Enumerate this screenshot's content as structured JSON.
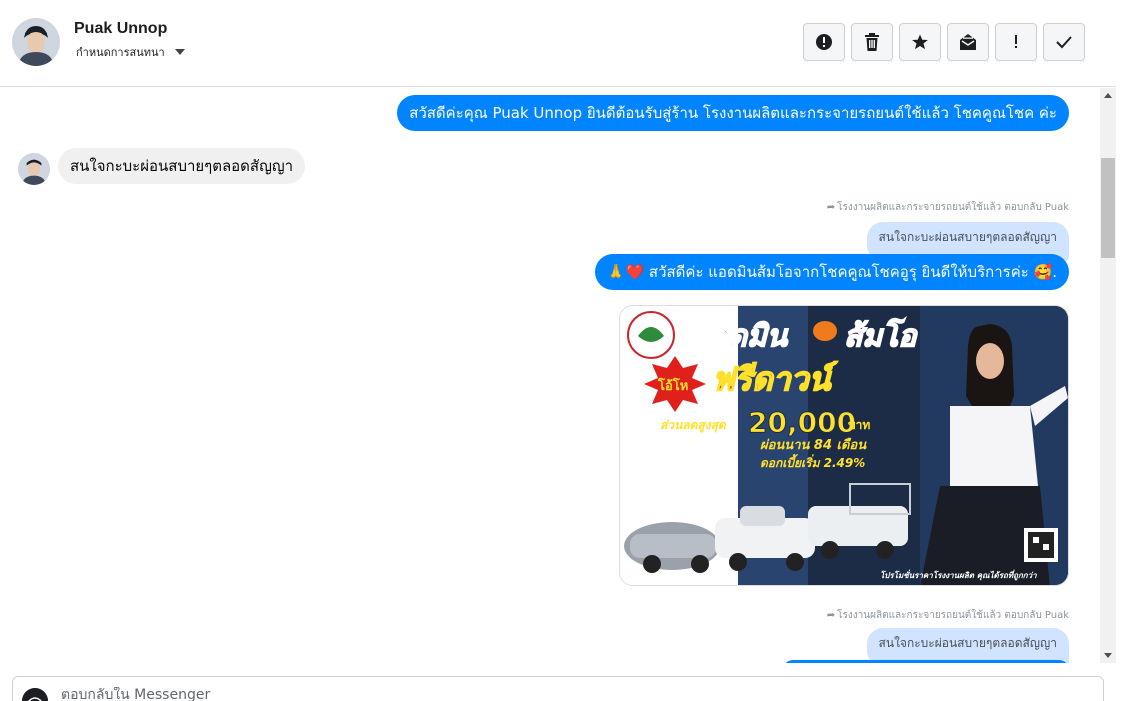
{
  "contact": {
    "name": "Puak Unnop",
    "assign_label": "กำหนดการสนทนา"
  },
  "toolbar": {
    "buttons": [
      {
        "name": "report-button",
        "icon": "alert-circle-icon"
      },
      {
        "name": "delete-button",
        "icon": "trash-icon"
      },
      {
        "name": "star-button",
        "icon": "star-icon"
      },
      {
        "name": "mark-unread-button",
        "icon": "envelope-icon"
      },
      {
        "name": "spam-button",
        "icon": "exclamation-icon"
      },
      {
        "name": "mark-done-button",
        "icon": "check-icon"
      }
    ]
  },
  "messages": {
    "m1": "สวัสดีค่ะคุณ Puak Unnop ยินดีต้อนรับสู่ร้าน โรงงานผลิตและกระจายรถยนต์ใช้แล้ว โชคคูณโชค ค่ะ",
    "m2": "สนใจกะบะผ่อนสบายๆตลอดสัญญา",
    "reply_note_1": "โรงงานผลิตและกระจายรถยนต์ใช้แล้ว ตอบกลับ Puak",
    "quote_1": "สนใจกะบะผ่อนสบายๆตลอดสัญญา",
    "m3": "🙏❤️ สวัสดีค่ะ แอดมินส้มโอจากโชคคูณโชคอูรุ ยินดีให้บริการค่ะ 🥰.",
    "reply_note_2": "โรงงานผลิตและกระจายรถยนต์ใช้แล้ว ตอบกลับ Puak",
    "quote_2": "สนใจกะบะผ่อนสบายๆตลอดสัญญา"
  },
  "promo": {
    "headline": "แอดมิน",
    "headline2": "ส้มโอ",
    "tag": "โอ้โห",
    "title": "ฟรีดาวน์",
    "discount_label": "ส่วนลดสูงสุด",
    "discount_amount": "20,000",
    "discount_unit": "บาท",
    "installment": "ผ่อนนาน 84 เดือน",
    "interest": "ดอกเบี้ยเริ่ม 2.49%",
    "footer": "โปรโมชั่นราคาโรงงานผลิต คุณได้รถที่ถูกกว่า",
    "colors": {
      "headline": "#e0201b",
      "yellow": "#ffe12b",
      "navy": "#1c2c47"
    }
  },
  "composer": {
    "placeholder": "ตอบกลับใน Messenger"
  },
  "colors": {
    "outgoing_bubble": "#0084ff",
    "incoming_bubble": "#f0f0f0",
    "quote_bubble": "#d0e3ff"
  }
}
